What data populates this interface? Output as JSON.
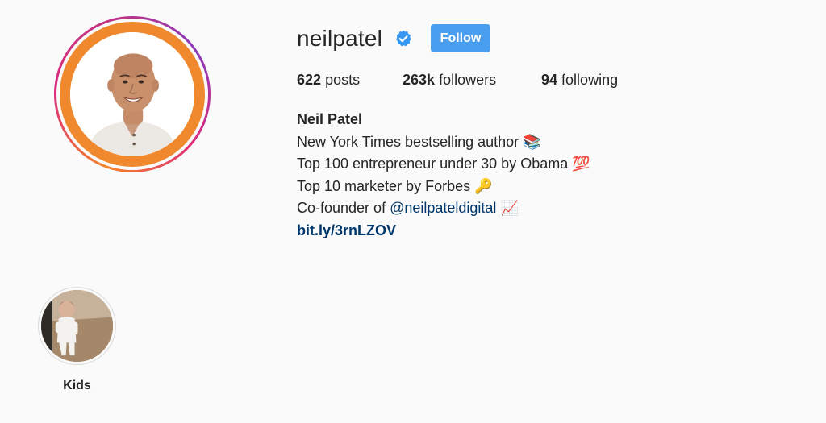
{
  "profile": {
    "username": "neilpatel",
    "verified_icon": "verified-badge-icon",
    "follow_label": "Follow",
    "accent_color": "#4a9ef0"
  },
  "stats": {
    "posts_count": "622",
    "posts_label": "posts",
    "followers_count": "263k",
    "followers_label": "followers",
    "following_count": "94",
    "following_label": "following"
  },
  "bio": {
    "full_name": "Neil Patel",
    "line1_text": "New York Times bestselling author",
    "line1_emoji": "📚",
    "line2_text": "Top 100 entrepreneur under 30 by Obama",
    "line2_emoji": "💯",
    "line3_text": "Top 10 marketer by Forbes",
    "line3_emoji": "🔑",
    "line4_prefix": "Co-founder of ",
    "line4_mention": "@neilpateldigital",
    "line4_emoji": "📈",
    "link": "bit.ly/3rnLZOV"
  },
  "highlights": [
    {
      "label": "Kids"
    }
  ]
}
